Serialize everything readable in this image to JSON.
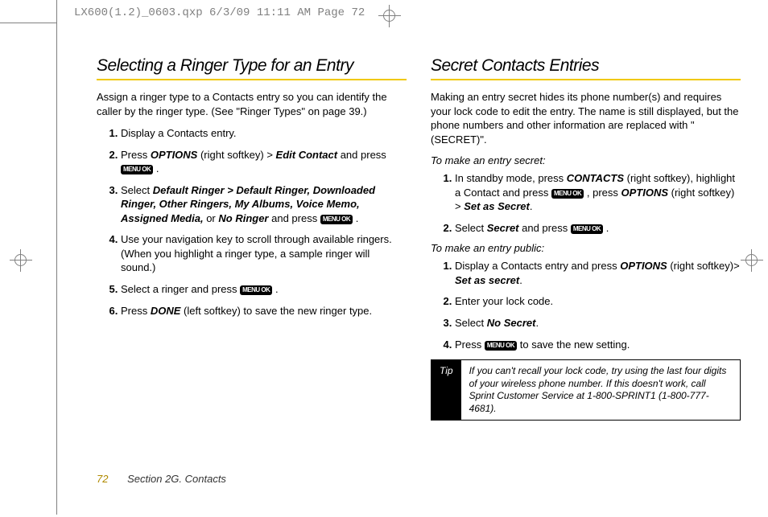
{
  "header": "LX600(1.2)_0603.qxp  6/3/09  11:11 AM  Page 72",
  "key_label": "MENU OK",
  "left": {
    "title": "Selecting a Ringer Type for an Entry",
    "intro": "Assign a ringer type to a Contacts entry so you can identify the caller by the ringer type. (See \"Ringer Types\" on page 39.)",
    "step1": "Display a Contacts entry.",
    "step2_a": "Press ",
    "step2_options": "OPTIONS",
    "step2_b": " (right softkey) ",
    "step2_gt": ">",
    "step2_edit": " Edit Contact",
    "step2_c": " and press ",
    "step3_a": "Select ",
    "step3_list": "Default Ringer > Default Ringer, Downloaded Ringer, Other Ringers, My Albums, Voice Memo, Assigned Media,",
    "step3_or": " or ",
    "step3_noringer": "No Ringer",
    "step3_b": " and press ",
    "step4": "Use your navigation key to scroll through available ringers. (When you highlight a ringer type, a sample ringer will sound.)",
    "step5_a": "Select a ringer and press ",
    "step6_a": "Press ",
    "step6_done": "DONE",
    "step6_b": " (left softkey) to save the new ringer type."
  },
  "right": {
    "title": "Secret Contacts Entries",
    "intro": "Making an entry secret hides its phone number(s) and requires your lock code to edit the entry. The name is still displayed, but the phone numbers and other information are replaced with \"(SECRET)\".",
    "sub1": "To make an entry secret:",
    "s1_1a": "In standby mode, press ",
    "s1_1contacts": "CONTACTS",
    "s1_1b": " (right softkey), highlight a Contact and press ",
    "s1_1c": " , press ",
    "s1_1options": "OPTIONS",
    "s1_1d": " (right softkey) ",
    "s1_1gt": ">",
    "s1_1setsecret": " Set as Secret",
    "s1_2a": "Select ",
    "s1_2secret": "Secret",
    "s1_2b": " and press ",
    "sub2": "To make an entry public:",
    "s2_1a": "Display a Contacts entry and press ",
    "s2_1options": "OPTIONS",
    "s2_1b": " (right softkey)",
    "s2_1gt": ">",
    "s2_1setsecret": " Set as secret",
    "s2_2": "Enter your lock code.",
    "s2_3a": "Select ",
    "s2_3nosecret": "No Secret",
    "s2_4a": "Press ",
    "s2_4b": " to save the new setting.",
    "tip_label": "Tip",
    "tip_text": "If you can't recall your lock code, try using the last four digits of your wireless phone number. If this doesn't work, call Sprint Customer Service at 1-800-SPRINT1 (1-800-777-4681)."
  },
  "footer": {
    "page": "72",
    "section": "Section 2G. Contacts"
  }
}
